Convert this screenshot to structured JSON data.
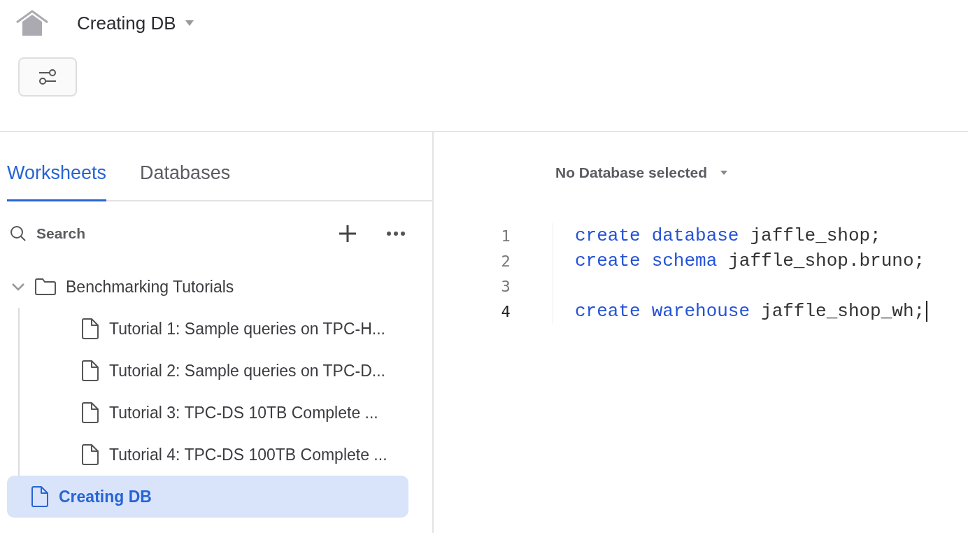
{
  "header": {
    "title": "Creating DB"
  },
  "tabs": [
    {
      "label": "Worksheets",
      "selected": true
    },
    {
      "label": "Databases",
      "selected": false
    }
  ],
  "search": {
    "placeholder": "Search"
  },
  "tree": [
    {
      "label": "Benchmarking Tutorials",
      "kind": "folder",
      "expanded": true,
      "selected": false,
      "children": [
        {
          "label": "Tutorial 1: Sample queries on TPC-H...",
          "kind": "file",
          "selected": false
        },
        {
          "label": "Tutorial 2: Sample queries on TPC-D...",
          "kind": "file",
          "selected": false
        },
        {
          "label": "Tutorial 3: TPC-DS 10TB Complete ...",
          "kind": "file",
          "selected": false
        },
        {
          "label": "Tutorial 4: TPC-DS 100TB Complete ...",
          "kind": "file",
          "selected": false
        }
      ]
    },
    {
      "label": "Creating DB",
      "kind": "file",
      "selected": true
    }
  ],
  "database_selector": {
    "label": "No Database selected"
  },
  "editor": {
    "lines": [
      {
        "number": "1",
        "active": false,
        "tokens": [
          {
            "text": "create",
            "kind": "keyword"
          },
          {
            "text": "database",
            "kind": "keyword"
          },
          {
            "text": "jaffle_shop;",
            "kind": "ident"
          }
        ]
      },
      {
        "number": "2",
        "active": false,
        "tokens": [
          {
            "text": "create",
            "kind": "keyword"
          },
          {
            "text": "schema",
            "kind": "keyword"
          },
          {
            "text": "jaffle_shop.bruno;",
            "kind": "ident"
          }
        ]
      },
      {
        "number": "3",
        "active": false
      },
      {
        "number": "4",
        "active": true,
        "tokens": [
          {
            "text": "create",
            "kind": "keyword"
          },
          {
            "text": "warehouse",
            "kind": "keyword"
          },
          {
            "text": "jaffle_shop_wh;",
            "kind": "ident"
          }
        ]
      }
    ]
  }
}
